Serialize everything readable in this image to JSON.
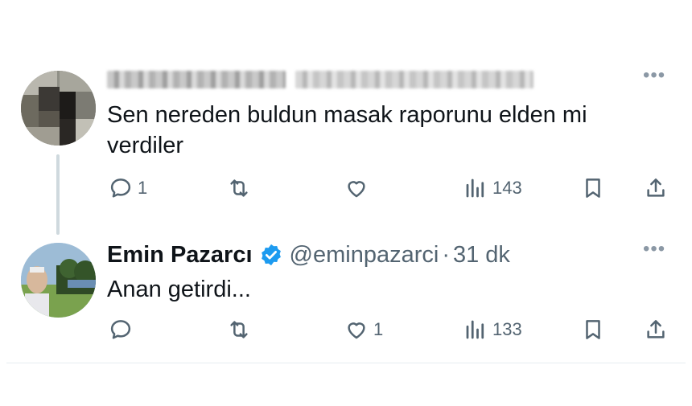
{
  "thread": {
    "reply_to_tweet": {
      "author_name_blurred": "",
      "text": "Sen nereden buldun masak raporunu elden mi verdiler",
      "more_icon": "more-horizontal-icon",
      "actions": {
        "reply_count": "1",
        "retweet_count": "",
        "like_count": "",
        "views_count": "143"
      }
    },
    "reply_tweet": {
      "author_name": "Emin Pazarcı",
      "handle": "@eminpazarci",
      "separator": "·",
      "time": "31 dk",
      "text": "Anan getirdi...",
      "verified_icon": "verified-badge-icon",
      "more_icon": "more-horizontal-icon",
      "actions": {
        "reply_count": "",
        "retweet_count": "",
        "like_count": "1",
        "views_count": "133"
      }
    }
  },
  "colors": {
    "text": "#0f1419",
    "secondary": "#536471",
    "verified": "#1d9bf0",
    "thread_line": "#cfd9de"
  }
}
